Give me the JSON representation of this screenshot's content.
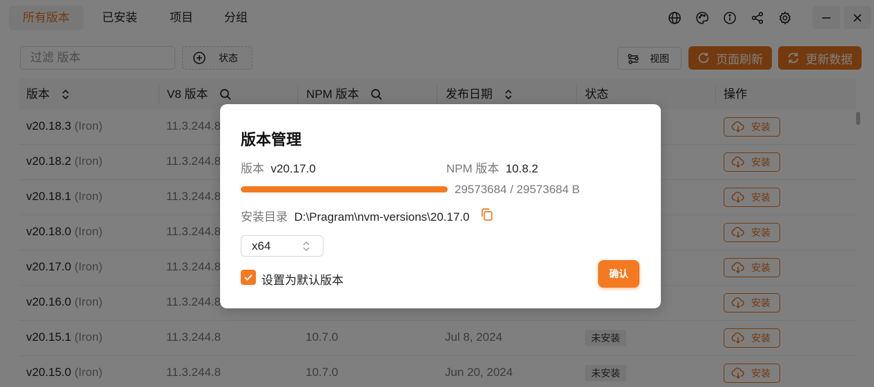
{
  "nav": {
    "tabs": [
      {
        "label": "所有版本",
        "active": true
      },
      {
        "label": "已安装",
        "active": false
      },
      {
        "label": "项目",
        "active": false
      },
      {
        "label": "分组",
        "active": false
      }
    ],
    "icons": [
      "globe-icon",
      "palette-icon",
      "info-icon",
      "share-icon",
      "settings-icon"
    ],
    "window_controls": [
      "minimize-icon",
      "close-icon"
    ]
  },
  "toolbar": {
    "filter_placeholder": "过滤 版本",
    "status_label": "状态",
    "view_label": "视图",
    "refresh_page_label": "页面刷新",
    "update_data_label": "更新数据"
  },
  "table": {
    "headers": [
      "版本",
      "V8 版本",
      "NPM 版本",
      "发布日期",
      "状态",
      "操作"
    ],
    "rows": [
      {
        "version": "v20.18.3",
        "lts": "(Iron)",
        "v8": "11.3.244.8",
        "npm": "",
        "date": "",
        "status": "",
        "action": "安装"
      },
      {
        "version": "v20.18.2",
        "lts": "(Iron)",
        "v8": "11.3.244.8",
        "npm": "",
        "date": "",
        "status": "",
        "action": "安装"
      },
      {
        "version": "v20.18.1",
        "lts": "(Iron)",
        "v8": "11.3.244.8",
        "npm": "",
        "date": "",
        "status": "",
        "action": "安装"
      },
      {
        "version": "v20.18.0",
        "lts": "(Iron)",
        "v8": "11.3.244.8",
        "npm": "",
        "date": "",
        "status": "",
        "action": "安装"
      },
      {
        "version": "v20.17.0",
        "lts": "(Iron)",
        "v8": "11.3.244.8",
        "npm": "",
        "date": "",
        "status": "",
        "action": "安装"
      },
      {
        "version": "v20.16.0",
        "lts": "(Iron)",
        "v8": "11.3.244.8",
        "npm": "",
        "date": "",
        "status": "",
        "action": "安装"
      },
      {
        "version": "v20.15.1",
        "lts": "(Iron)",
        "v8": "11.3.244.8",
        "npm": "10.7.0",
        "date": "Jul 8, 2024",
        "status": "未安装",
        "action": "安装"
      },
      {
        "version": "v20.15.0",
        "lts": "(Iron)",
        "v8": "11.3.244.8",
        "npm": "10.7.0",
        "date": "Jun 20, 2024",
        "status": "未安装",
        "action": "安装"
      }
    ]
  },
  "modal": {
    "title": "版本管理",
    "version_label": "版本",
    "version_value": "v20.17.0",
    "npm_label": "NPM 版本",
    "npm_value": "10.8.2",
    "progress_text": "29573684 / 29573684 B",
    "progress_fraction": 1.0,
    "dir_label": "安装目录",
    "dir_value": "D:\\Pragram\\nvm-versions\\20.17.0",
    "arch_value": "x64",
    "default_checked": true,
    "default_label": "设置为默认版本",
    "confirm_label": "确认"
  },
  "colors": {
    "accent": "#e8741e",
    "accent_modal": "#f47920"
  }
}
